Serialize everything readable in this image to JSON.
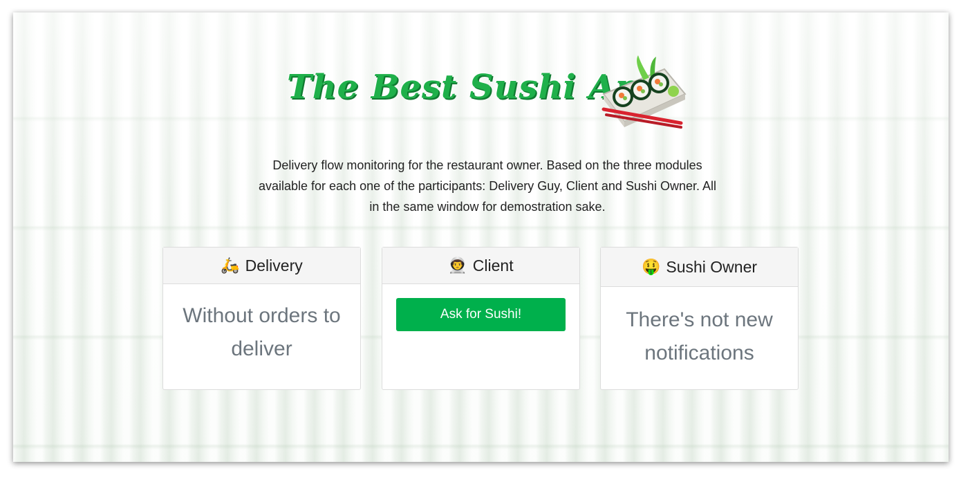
{
  "header": {
    "title": "The Best Sushi App",
    "logo_icon": "sushi-plate-icon",
    "brand_color": "#1fb04a"
  },
  "description": "Delivery flow monitoring for the restaurant owner. Based on the three modules available for each one of the participants: Delivery Guy, Client and Sushi Owner. All in the same window for demostration sake.",
  "modules": {
    "delivery": {
      "icon": "🛵",
      "icon_name": "scooter-icon",
      "title": "Delivery",
      "empty_text": "Without orders to deliver"
    },
    "client": {
      "icon": "👨‍🚀",
      "icon_name": "astronaut-icon",
      "title": "Client",
      "button_label": "Ask for Sushi!",
      "button_color": "#00b04c"
    },
    "owner": {
      "icon": "🤑",
      "icon_name": "money-mouth-face-icon",
      "title": "Sushi Owner",
      "empty_text": "There's not new notifications"
    }
  }
}
